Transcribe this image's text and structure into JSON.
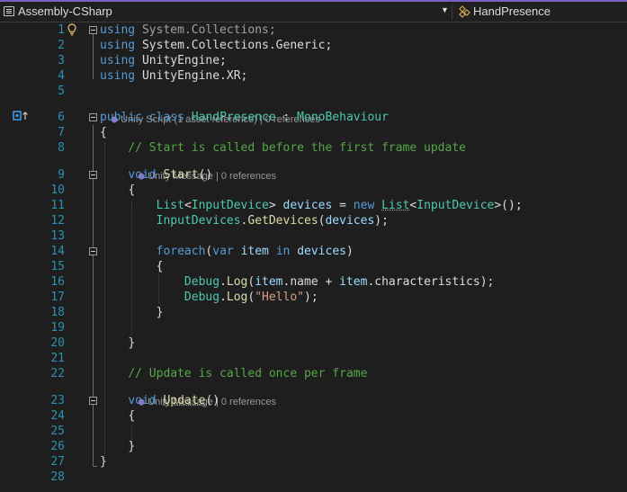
{
  "topbar": {
    "project": "Assembly-CSharp",
    "class_dropdown": "HandPresence"
  },
  "codelens": {
    "class_lens": "Unity Script (1 asset reference) | 0 references",
    "start_lens": "Unity Message | 0 references",
    "update_lens": "Unity Message | 0 references"
  },
  "lines": [
    {
      "n": "1"
    },
    {
      "n": "2"
    },
    {
      "n": "3"
    },
    {
      "n": "4"
    },
    {
      "n": "5"
    },
    {
      "n": "6"
    },
    {
      "n": "7"
    },
    {
      "n": "8"
    },
    {
      "n": "9"
    },
    {
      "n": "10"
    },
    {
      "n": "11"
    },
    {
      "n": "12"
    },
    {
      "n": "13"
    },
    {
      "n": "14"
    },
    {
      "n": "15"
    },
    {
      "n": "16"
    },
    {
      "n": "17"
    },
    {
      "n": "18"
    },
    {
      "n": "19"
    },
    {
      "n": "20"
    },
    {
      "n": "21"
    },
    {
      "n": "22"
    },
    {
      "n": "23"
    },
    {
      "n": "24"
    },
    {
      "n": "25"
    },
    {
      "n": "26"
    },
    {
      "n": "27"
    },
    {
      "n": "28"
    }
  ],
  "tokens": {
    "using": "using",
    "ns1": " System.Collections;",
    "ns2": " System.Collections.Generic;",
    "ns3": " UnityEngine;",
    "ns4": " UnityEngine.XR;",
    "public": "public",
    "class": "class",
    "class_name": "HandPresence",
    "colon": " : ",
    "base": "MonoBehaviour",
    "brace_open": "{",
    "brace_close": "}",
    "comment_start": "// Start is called before the first frame update",
    "void": "void",
    "start": "Start",
    "parens": "()",
    "list": "List",
    "lt": "<",
    "gt": ">",
    "input_device": "InputDevice",
    "devices": "devices",
    "eq": " = ",
    "new": "new",
    "ctor_end": "();",
    "input_devices": "InputDevices",
    "dot": ".",
    "get_devices": "GetDevices",
    "lparen": "(",
    "rparen_semi": ");",
    "foreach": "foreach",
    "var": "var",
    "item": "item",
    "in": "in",
    "rparen": ")",
    "debug": "Debug",
    "log": "Log",
    "name": "name",
    "plus": " + ",
    "characteristics": "characteristics",
    "hello": "\"Hello\"",
    "comment_update": "// Update is called once per frame",
    "update": "Update"
  }
}
